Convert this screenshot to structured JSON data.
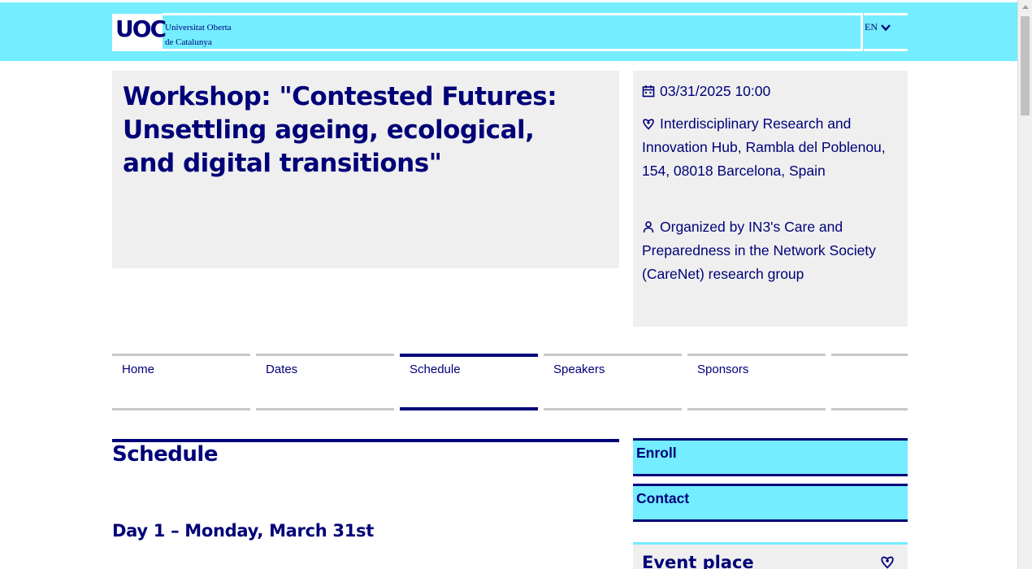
{
  "header": {
    "logo_text": "UOC",
    "university_line1": "Universitat Oberta",
    "university_line2": "de Catalunya",
    "language": "EN"
  },
  "event": {
    "title": "Workshop: \"Contested Futures: Unsettling ageing, ecological, and digital transitions\"",
    "datetime": "03/31/2025 10:00",
    "location": "Interdisciplinary Research and Innovation Hub, Rambla del Poblenou, 154, 08018 Barcelona, Spain",
    "organizer": "Organized by IN3's Care and Preparedness in the Network Society (CareNet) research group"
  },
  "nav": {
    "tabs": [
      {
        "label": "Home"
      },
      {
        "label": "Dates"
      },
      {
        "label": "Schedule"
      },
      {
        "label": "Speakers"
      },
      {
        "label": "Sponsors"
      },
      {
        "label": ""
      }
    ],
    "active": "Schedule"
  },
  "main": {
    "heading": "Schedule",
    "day1": "Day 1 – Monday, March 31st"
  },
  "sidebar": {
    "enroll": "Enroll",
    "contact": "Contact",
    "event_place": "Event place"
  },
  "colors": {
    "brand_navy": "#000078",
    "brand_cyan": "#73edff",
    "panel_grey": "#efefef"
  }
}
